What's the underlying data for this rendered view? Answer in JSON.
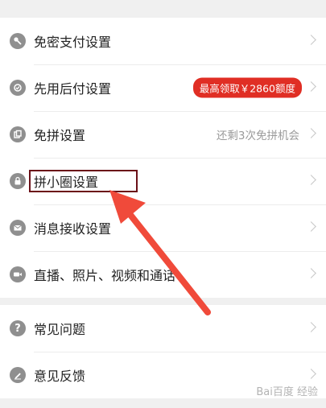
{
  "settings_group1": [
    {
      "label": "免密支付设置",
      "icon": "key-icon"
    },
    {
      "label": "先用后付设置",
      "icon": "badge-seal-icon",
      "badge": "最高领取￥2860额度"
    },
    {
      "label": "免拼设置",
      "icon": "group-icon",
      "hint": "还剩3次免拼机会"
    },
    {
      "label": "拼小圈设置",
      "icon": "lock-icon"
    },
    {
      "label": "消息接收设置",
      "icon": "mail-icon"
    },
    {
      "label": "直播、照片、视频和通话",
      "icon": "video-camera-icon"
    }
  ],
  "settings_group2": [
    {
      "label": "常见问题",
      "icon": "question-icon"
    },
    {
      "label": "意见反馈",
      "icon": "edit-icon"
    }
  ],
  "watermark": "Bai百度 经验",
  "colors": {
    "badge_bg": "#e02e24",
    "arrow": "#f04a3a",
    "highlight_border": "#6b1018"
  }
}
